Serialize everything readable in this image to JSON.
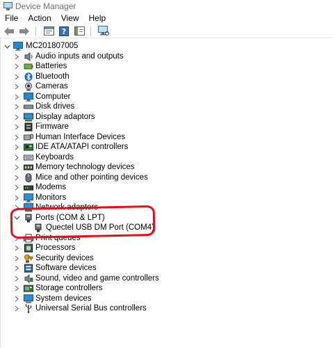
{
  "window": {
    "title": "Device Manager"
  },
  "menu": [
    "File",
    "Action",
    "View",
    "Help"
  ],
  "toolbar": [
    {
      "name": "back-arrow-icon"
    },
    {
      "name": "forward-arrow-icon"
    },
    {
      "name": "properties-panel-icon"
    },
    {
      "name": "help-icon"
    },
    {
      "name": "console-pane-icon"
    },
    {
      "name": "scan-hardware-icon"
    }
  ],
  "tree": {
    "root": "MC201807005",
    "categories": [
      {
        "label": "Audio inputs and outputs",
        "icon": "speaker-icon"
      },
      {
        "label": "Batteries",
        "icon": "battery-icon"
      },
      {
        "label": "Bluetooth",
        "icon": "bluetooth-icon"
      },
      {
        "label": "Cameras",
        "icon": "camera-icon"
      },
      {
        "label": "Computer",
        "icon": "computer-icon"
      },
      {
        "label": "Disk drives",
        "icon": "disk-drive-icon"
      },
      {
        "label": "Display adaptors",
        "icon": "display-adapter-icon"
      },
      {
        "label": "Firmware",
        "icon": "firmware-icon"
      },
      {
        "label": "Human Interface Devices",
        "icon": "hid-icon"
      },
      {
        "label": "IDE ATA/ATAPI controllers",
        "icon": "ide-controller-icon"
      },
      {
        "label": "Keyboards",
        "icon": "keyboard-icon"
      },
      {
        "label": "Memory technology devices",
        "icon": "memory-icon"
      },
      {
        "label": "Mice and other pointing devices",
        "icon": "mouse-icon"
      },
      {
        "label": "Modems",
        "icon": "modem-icon"
      },
      {
        "label": "Monitors",
        "icon": "monitor-icon"
      },
      {
        "label": "Network adapters",
        "icon": "network-adapter-icon"
      },
      {
        "label": "Ports (COM & LPT)",
        "icon": "port-icon",
        "expanded": true,
        "children": [
          {
            "label": "Quectel USB DM Port (COM4)",
            "icon": "port-icon"
          }
        ]
      },
      {
        "label": "Print queues",
        "icon": "printer-icon"
      },
      {
        "label": "Processors",
        "icon": "processor-icon"
      },
      {
        "label": "Security devices",
        "icon": "security-device-icon"
      },
      {
        "label": "Software devices",
        "icon": "software-device-icon"
      },
      {
        "label": "Sound, video and game controllers",
        "icon": "sound-controller-icon"
      },
      {
        "label": "Storage controllers",
        "icon": "storage-controller-icon"
      },
      {
        "label": "System devices",
        "icon": "system-device-icon"
      },
      {
        "label": "Universal Serial Bus controllers",
        "icon": "usb-icon"
      }
    ]
  },
  "colors": {
    "annotation": "#e0101e",
    "accent": "#0078d7"
  }
}
